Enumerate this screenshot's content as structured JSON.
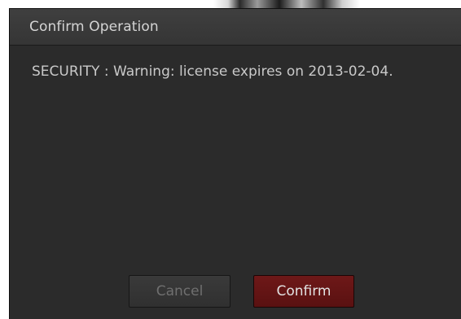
{
  "dialog": {
    "title": "Confirm Operation",
    "message": "SECURITY : Warning:  license expires on 2013-02-04.",
    "cancel_label": "Cancel",
    "confirm_label": "Confirm"
  },
  "colors": {
    "dialog_bg": "#2b2b2b",
    "confirm_accent": "#6e1818",
    "text": "#c9c9c9",
    "disabled_text": "#6f6f6f"
  }
}
